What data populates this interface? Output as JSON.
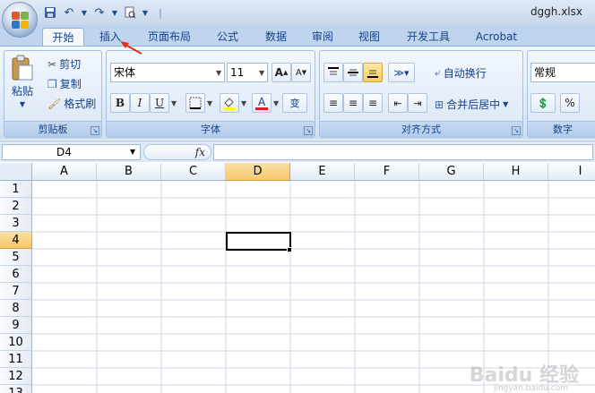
{
  "title_bar": {
    "doc_name": "dggh.xlsx"
  },
  "tabs": [
    "开始",
    "插入",
    "页面布局",
    "公式",
    "数据",
    "审阅",
    "视图",
    "开发工具",
    "Acrobat"
  ],
  "clipboard": {
    "paste": "粘贴",
    "cut": "剪切",
    "copy": "复制",
    "format_painter": "格式刷",
    "label": "剪贴板"
  },
  "font": {
    "name": "宋体",
    "size": "11",
    "label": "字体",
    "bold": "B",
    "italic": "I",
    "underline": "U",
    "wen": "变"
  },
  "alignment": {
    "wrap": "自动换行",
    "merge": "合并后居中",
    "label": "对齐方式"
  },
  "number": {
    "format": "常规",
    "percent": "%",
    "label": "数字"
  },
  "formula_bar": {
    "name_box": "D4",
    "fx": "fx"
  },
  "columns": [
    "A",
    "B",
    "C",
    "D",
    "E",
    "F",
    "G",
    "H",
    "I"
  ],
  "rows": [
    "1",
    "2",
    "3",
    "4",
    "5",
    "6",
    "7",
    "8",
    "9",
    "10",
    "11",
    "12",
    "13"
  ],
  "active_cell": "D4",
  "watermark": {
    "main": "Baidu 经验",
    "sub": "jingyan.baidu.com"
  },
  "colors": {
    "accent": "#15428b",
    "selection": "#f7c76b",
    "annotation_arrow": "#e0301e"
  }
}
